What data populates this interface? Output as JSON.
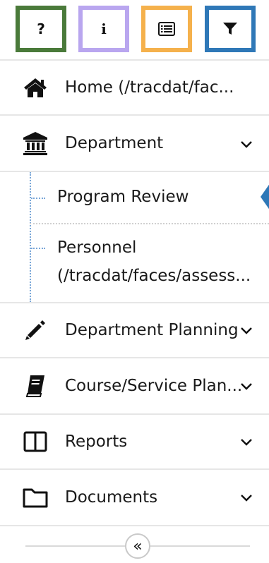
{
  "toolbar": {
    "help_glyph": "?",
    "info_glyph": "i",
    "list_icon": "list-icon",
    "filter_icon": "filter-icon",
    "colors": {
      "help": "#4a7a3a",
      "info": "#b9a6ef",
      "list": "#f5b14c",
      "filter": "#2f78b7"
    }
  },
  "nav": {
    "home": {
      "label": "Home (/tracdat/fac...",
      "icon": "home-icon"
    },
    "department": {
      "label": "Department",
      "icon": "institution-icon",
      "expanded": true,
      "children": [
        {
          "label": "Program Review",
          "active": true
        },
        {
          "label_line1": "Personnel",
          "label_line2": "(/tracdat/faces/assess..."
        }
      ]
    },
    "department_planning": {
      "label": "Department Planning",
      "icon": "pencil-icon"
    },
    "course_service": {
      "label": "Course/Service Plan...",
      "icon": "book-icon"
    },
    "reports": {
      "label": "Reports",
      "icon": "columns-icon"
    },
    "documents": {
      "label": "Documents",
      "icon": "folder-icon"
    }
  },
  "collapse": {
    "glyph": "«"
  },
  "accent_color": "#2f78b7"
}
